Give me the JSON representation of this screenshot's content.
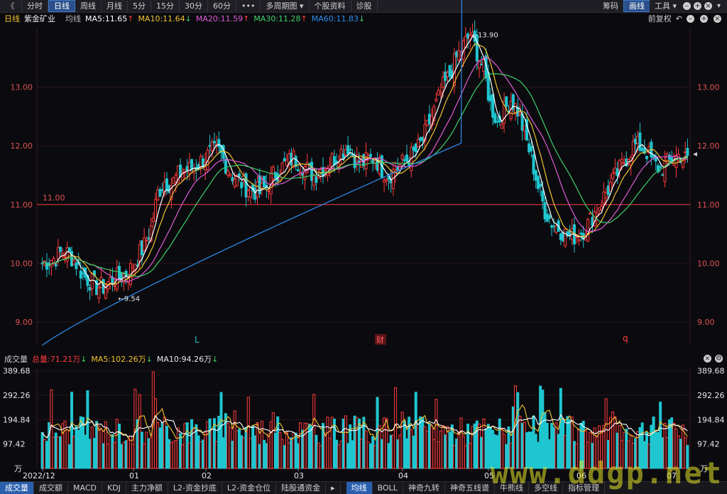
{
  "toolbar": {
    "back_icon": "《",
    "items": [
      "分时",
      "日线",
      "周线",
      "月线",
      "5分",
      "15分",
      "30分",
      "60分",
      "•••",
      "多周期图 ▾",
      "个股资料",
      "诊股"
    ],
    "active_index": 1,
    "right_items": [
      "筹码",
      "画线",
      "工具 ▾"
    ]
  },
  "legend": {
    "period": "日线",
    "stock": "紫金矿业",
    "avg": "均线",
    "ma5": "MA5:11.65",
    "ma10": "MA10:11.64",
    "ma20": "MA20:11.59",
    "ma30": "MA30:11.28",
    "ma60": "MA60:11.83",
    "right_label": "前复权"
  },
  "price_axis": {
    "ticks": [
      "13.00",
      "12.00",
      "11.00",
      "10.00",
      "9.00"
    ],
    "tick_values": [
      13,
      12,
      11,
      10,
      9
    ],
    "ref_line_label": "11.00",
    "high_label": "13.90",
    "low_label": "9.54",
    "markers": [
      "L",
      "财",
      "q"
    ]
  },
  "volume": {
    "title": "成交量",
    "total": "总量:71.21万",
    "ma5": "MA5:102.26万",
    "ma10": "MA10:94.26万",
    "ticks": [
      "389.68",
      "292.26",
      "194.84",
      "97.42",
      "万"
    ],
    "tick_values": [
      389.68,
      292.26,
      194.84,
      97.42
    ]
  },
  "dates": [
    "2022/12",
    "01",
    "02",
    "03",
    "04",
    "05",
    "06",
    "07"
  ],
  "bottom_tabs": [
    "成交量",
    "成交额",
    "MACD",
    "KDJ",
    "主力净额",
    "L2-资金抄底",
    "L2-资金仓位",
    "陆股通资金",
    "▸"
  ],
  "bottom_tabs2": [
    "均线",
    "BOLL",
    "神奇九转",
    "神奇五线谱",
    "牛熊线",
    "多空线",
    "指标管理"
  ],
  "watermark": "www.ddgp.net",
  "colors": {
    "up": "#ff3b3b",
    "down": "#1fc6d0",
    "ma5": "#ffffff",
    "ma10": "#f2c230",
    "ma20": "#e05ad8",
    "ma30": "#3fcf6a",
    "ma60": "#2e8df0",
    "grid": "#2a1418",
    "axis": "#e05050"
  },
  "chart_data": {
    "type": "candlestick",
    "note_values": "approximate series read from the picture",
    "ylim": [
      8.6,
      14.0
    ],
    "price_path": [
      10.0,
      10.05,
      10.1,
      10.2,
      10.15,
      10.0,
      9.8,
      9.7,
      9.6,
      9.6,
      9.7,
      9.75,
      9.8,
      9.9,
      10.1,
      10.3,
      10.6,
      11.2,
      11.4,
      11.35,
      11.5,
      11.6,
      11.6,
      11.7,
      11.8,
      11.9,
      11.9,
      11.7,
      11.5,
      11.4,
      11.3,
      11.25,
      11.2,
      11.3,
      11.5,
      11.6,
      11.7,
      11.8,
      11.7,
      11.6,
      11.5,
      11.6,
      11.7,
      11.8,
      11.9,
      12.0,
      11.8,
      11.7,
      11.75,
      11.8,
      11.6,
      11.5,
      11.6,
      11.7,
      11.8,
      11.9,
      12.1,
      12.4,
      12.7,
      13.0,
      13.2,
      13.5,
      13.7,
      13.9,
      13.6,
      13.3,
      12.7,
      12.4,
      12.6,
      12.8,
      12.6,
      12.2,
      11.8,
      11.3,
      10.9,
      10.7,
      10.6,
      10.5,
      10.45,
      10.5,
      10.6,
      10.8,
      11.0,
      11.2,
      11.4,
      11.6,
      11.8,
      12.0,
      12.0,
      11.9,
      11.7,
      11.6,
      11.7,
      11.8,
      11.85,
      11.75
    ],
    "volume_max": 389.68
  }
}
